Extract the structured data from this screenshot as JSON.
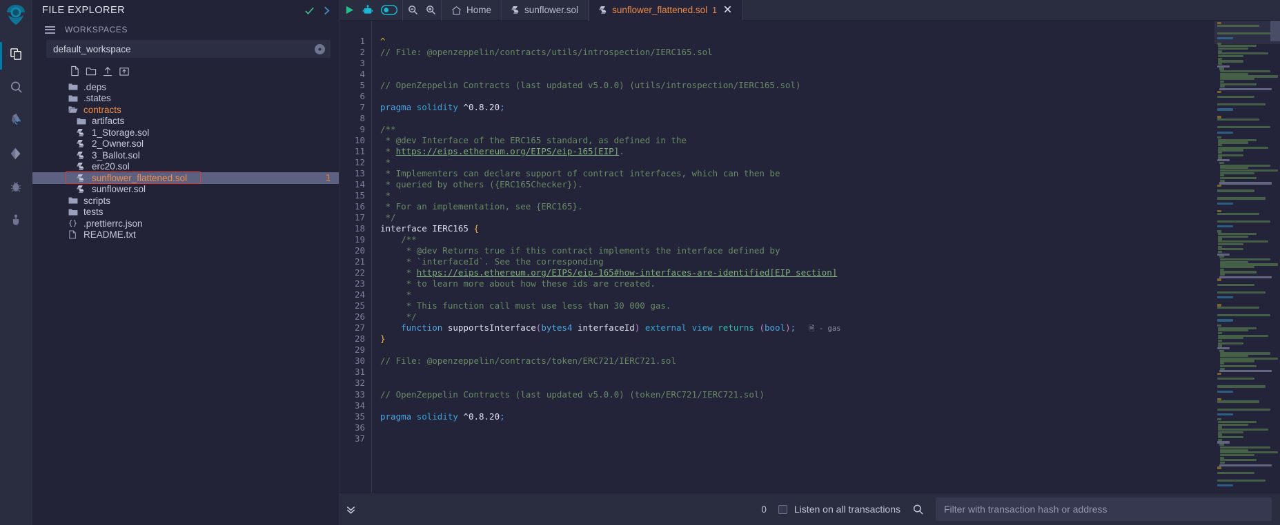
{
  "rail": {
    "logo": "remix-logo-icon",
    "items": [
      {
        "name": "file-explorer",
        "icon": "files-icon",
        "active": true
      },
      {
        "name": "search",
        "icon": "search-icon",
        "active": false
      },
      {
        "name": "solidity-compiler",
        "icon": "compiler-icon",
        "active": false
      },
      {
        "name": "deploy-run-transactions",
        "icon": "ethereum-icon",
        "active": false
      },
      {
        "name": "debugger",
        "icon": "bug-icon",
        "active": false
      },
      {
        "name": "plugin-manager",
        "icon": "plug-icon",
        "active": false
      }
    ]
  },
  "explorer": {
    "title": "FILE EXPLORER",
    "check_icon": "check-icon",
    "chevron_icon": "chevron-right-icon",
    "workspaces_label": "WORKSPACES",
    "workspace_selected": "default_workspace",
    "toolbar": [
      {
        "name": "create-new-file",
        "icon": "new-file-icon"
      },
      {
        "name": "create-new-folder",
        "icon": "new-folder-icon"
      },
      {
        "name": "publish-to-gist",
        "icon": "upload-icon"
      },
      {
        "name": "upload-folder",
        "icon": "upload-folder-icon"
      }
    ],
    "tree": [
      {
        "label": ".deps",
        "type": "folder",
        "depth": 0,
        "open": false,
        "selected": false
      },
      {
        "label": ".states",
        "type": "folder",
        "depth": 0,
        "open": false,
        "selected": false
      },
      {
        "label": "contracts",
        "type": "folder",
        "depth": 0,
        "open": true,
        "selected": false,
        "orange": true
      },
      {
        "label": "artifacts",
        "type": "folder",
        "depth": 1,
        "open": false,
        "selected": false
      },
      {
        "label": "1_Storage.sol",
        "type": "sol",
        "depth": 1,
        "selected": false
      },
      {
        "label": "2_Owner.sol",
        "type": "sol",
        "depth": 1,
        "selected": false
      },
      {
        "label": "3_Ballot.sol",
        "type": "sol",
        "depth": 1,
        "selected": false
      },
      {
        "label": "erc20.sol",
        "type": "sol",
        "depth": 1,
        "selected": false
      },
      {
        "label": "sunflower_flattened.sol",
        "type": "sol",
        "depth": 1,
        "selected": true,
        "badge": "1",
        "highlight_box": true
      },
      {
        "label": "sunflower.sol",
        "type": "sol",
        "depth": 1,
        "selected": false
      },
      {
        "label": "scripts",
        "type": "folder",
        "depth": 0,
        "open": false,
        "selected": false
      },
      {
        "label": "tests",
        "type": "folder",
        "depth": 0,
        "open": false,
        "selected": false
      },
      {
        "label": ".prettierrc.json",
        "type": "json",
        "depth": 0,
        "selected": false
      },
      {
        "label": "README.txt",
        "type": "txt",
        "depth": 0,
        "selected": false
      }
    ]
  },
  "tabbar": {
    "actions": [
      {
        "name": "run-script-button",
        "icon": "play-icon"
      },
      {
        "name": "remix-ai-button",
        "icon": "robot-icon"
      },
      {
        "name": "ai-toggle",
        "icon": "toggle-on-icon"
      }
    ],
    "zoom_actions": [
      {
        "name": "zoom-out-button",
        "icon": "zoom-out-icon"
      },
      {
        "name": "zoom-in-button",
        "icon": "zoom-in-icon"
      }
    ],
    "tabs": [
      {
        "label": "Home",
        "icon": "home-icon",
        "active": false,
        "closable": false
      },
      {
        "label": "sunflower.sol",
        "icon": "solidity-icon",
        "active": false,
        "closable": false
      },
      {
        "label": "sunflower_flattened.sol",
        "icon": "solidity-icon",
        "active": true,
        "badge": "1",
        "closable": true,
        "close_icon": "close-icon"
      }
    ]
  },
  "editor": {
    "first_line_number": 1,
    "last_line_number": 37,
    "gas_note": "- gas",
    "lines": [
      {
        "n": 1,
        "tokens": [
          {
            "t": "^",
            "c": "c-brace"
          }
        ]
      },
      {
        "n": 2,
        "tokens": [
          {
            "t": "// File: @openzeppelin/contracts/utils/introspection/IERC165.sol",
            "c": "c-com"
          }
        ]
      },
      {
        "n": 3,
        "tokens": []
      },
      {
        "n": 4,
        "tokens": []
      },
      {
        "n": 5,
        "tokens": [
          {
            "t": "// OpenZeppelin Contracts (last updated v5.0.0) (utils/introspection/IERC165.sol)",
            "c": "c-com"
          }
        ]
      },
      {
        "n": 6,
        "tokens": []
      },
      {
        "n": 7,
        "tokens": [
          {
            "t": "pragma",
            "c": "c-kw"
          },
          {
            "t": " ",
            "c": "c-plain"
          },
          {
            "t": "solidity",
            "c": "c-kw2"
          },
          {
            "t": " ^0.8.20",
            "c": "c-plain"
          },
          {
            "t": ";",
            "c": "c-kw"
          }
        ]
      },
      {
        "n": 8,
        "tokens": []
      },
      {
        "n": 9,
        "tokens": [
          {
            "t": "/**",
            "c": "c-com"
          }
        ]
      },
      {
        "n": 10,
        "tokens": [
          {
            "t": " * @dev Interface of the ERC165 standard, as defined in the",
            "c": "c-com"
          }
        ]
      },
      {
        "n": 11,
        "tokens": [
          {
            "t": " * ",
            "c": "c-com"
          },
          {
            "t": "https://eips.ethereum.org/EIPS/eip-165[EIP]",
            "c": "c-link"
          },
          {
            "t": ".",
            "c": "c-com"
          }
        ]
      },
      {
        "n": 12,
        "tokens": [
          {
            "t": " *",
            "c": "c-com"
          }
        ]
      },
      {
        "n": 13,
        "tokens": [
          {
            "t": " * Implementers can declare support of contract interfaces, which can then be",
            "c": "c-com"
          }
        ]
      },
      {
        "n": 14,
        "tokens": [
          {
            "t": " * queried by others ({ERC165Checker}).",
            "c": "c-com"
          }
        ]
      },
      {
        "n": 15,
        "tokens": [
          {
            "t": " *",
            "c": "c-com"
          }
        ]
      },
      {
        "n": 16,
        "tokens": [
          {
            "t": " * For an implementation, see {ERC165}.",
            "c": "c-com"
          }
        ]
      },
      {
        "n": 17,
        "tokens": [
          {
            "t": " */",
            "c": "c-com"
          }
        ]
      },
      {
        "n": 18,
        "tokens": [
          {
            "t": "interface",
            "c": "c-plain"
          },
          {
            "t": " IERC165 ",
            "c": "c-plain"
          },
          {
            "t": "{",
            "c": "c-brace"
          }
        ]
      },
      {
        "n": 19,
        "tokens": [
          {
            "t": "    /**",
            "c": "c-com"
          }
        ]
      },
      {
        "n": 20,
        "tokens": [
          {
            "t": "     * @dev Returns true if this contract implements the interface defined by",
            "c": "c-com"
          }
        ]
      },
      {
        "n": 21,
        "tokens": [
          {
            "t": "     * `interfaceId`. See the corresponding",
            "c": "c-com"
          }
        ]
      },
      {
        "n": 22,
        "tokens": [
          {
            "t": "     * ",
            "c": "c-com"
          },
          {
            "t": "https://eips.ethereum.org/EIPS/eip-165#how-interfaces-are-identified[EIP section]",
            "c": "c-link"
          }
        ]
      },
      {
        "n": 23,
        "tokens": [
          {
            "t": "     * to learn more about how these ids are created.",
            "c": "c-com"
          }
        ]
      },
      {
        "n": 24,
        "tokens": [
          {
            "t": "     *",
            "c": "c-com"
          }
        ]
      },
      {
        "n": 25,
        "tokens": [
          {
            "t": "     * This function call must use less than 30 000 gas.",
            "c": "c-com"
          }
        ]
      },
      {
        "n": 26,
        "tokens": [
          {
            "t": "     */",
            "c": "c-com"
          }
        ]
      },
      {
        "n": 27,
        "tokens": [
          {
            "t": "    ",
            "c": "c-plain"
          },
          {
            "t": "function",
            "c": "c-kw"
          },
          {
            "t": " supportsInterface",
            "c": "c-plain"
          },
          {
            "t": "(",
            "c": "c-paren"
          },
          {
            "t": "bytes4",
            "c": "c-kw"
          },
          {
            "t": " interfaceId",
            "c": "c-plain"
          },
          {
            "t": ")",
            "c": "c-paren"
          },
          {
            "t": " ",
            "c": "c-plain"
          },
          {
            "t": "external",
            "c": "c-kw2"
          },
          {
            "t": " ",
            "c": "c-plain"
          },
          {
            "t": "view",
            "c": "c-kw2"
          },
          {
            "t": " ",
            "c": "c-plain"
          },
          {
            "t": "returns",
            "c": "c-type"
          },
          {
            "t": " ",
            "c": "c-plain"
          },
          {
            "t": "(",
            "c": "c-paren"
          },
          {
            "t": "bool",
            "c": "c-kw"
          },
          {
            "t": ")",
            "c": "c-paren"
          },
          {
            "t": ";",
            "c": "c-kw"
          }
        ],
        "gas": "- gas"
      },
      {
        "n": 28,
        "tokens": [
          {
            "t": "}",
            "c": "c-brace"
          }
        ]
      },
      {
        "n": 29,
        "tokens": []
      },
      {
        "n": 30,
        "tokens": [
          {
            "t": "// File: @openzeppelin/contracts/token/ERC721/IERC721.sol",
            "c": "c-com"
          }
        ]
      },
      {
        "n": 31,
        "tokens": []
      },
      {
        "n": 32,
        "tokens": []
      },
      {
        "n": 33,
        "tokens": [
          {
            "t": "// OpenZeppelin Contracts (last updated v5.0.0) (token/ERC721/IERC721.sol)",
            "c": "c-com"
          }
        ]
      },
      {
        "n": 34,
        "tokens": []
      },
      {
        "n": 35,
        "tokens": [
          {
            "t": "pragma",
            "c": "c-kw"
          },
          {
            "t": " ",
            "c": "c-plain"
          },
          {
            "t": "solidity",
            "c": "c-kw2"
          },
          {
            "t": " ^0.8.20",
            "c": "c-plain"
          },
          {
            "t": ";",
            "c": "c-kw"
          }
        ]
      },
      {
        "n": 36,
        "tokens": []
      },
      {
        "n": 37,
        "tokens": []
      }
    ]
  },
  "statusbar": {
    "expand_icon": "chevron-double-down-icon",
    "transaction_count": "0",
    "listen_checkbox_checked": false,
    "listen_label": "Listen on all transactions",
    "search_icon": "search-icon",
    "filter_placeholder": "Filter with transaction hash or address",
    "filter_value": ""
  },
  "colors": {
    "accent": "#ef8a42",
    "rail_active": "#007aa6",
    "selection": "#5c6182",
    "highlight_border": "#e23b3b",
    "comment": "#698a63",
    "keyword": "#4fa6e0"
  }
}
